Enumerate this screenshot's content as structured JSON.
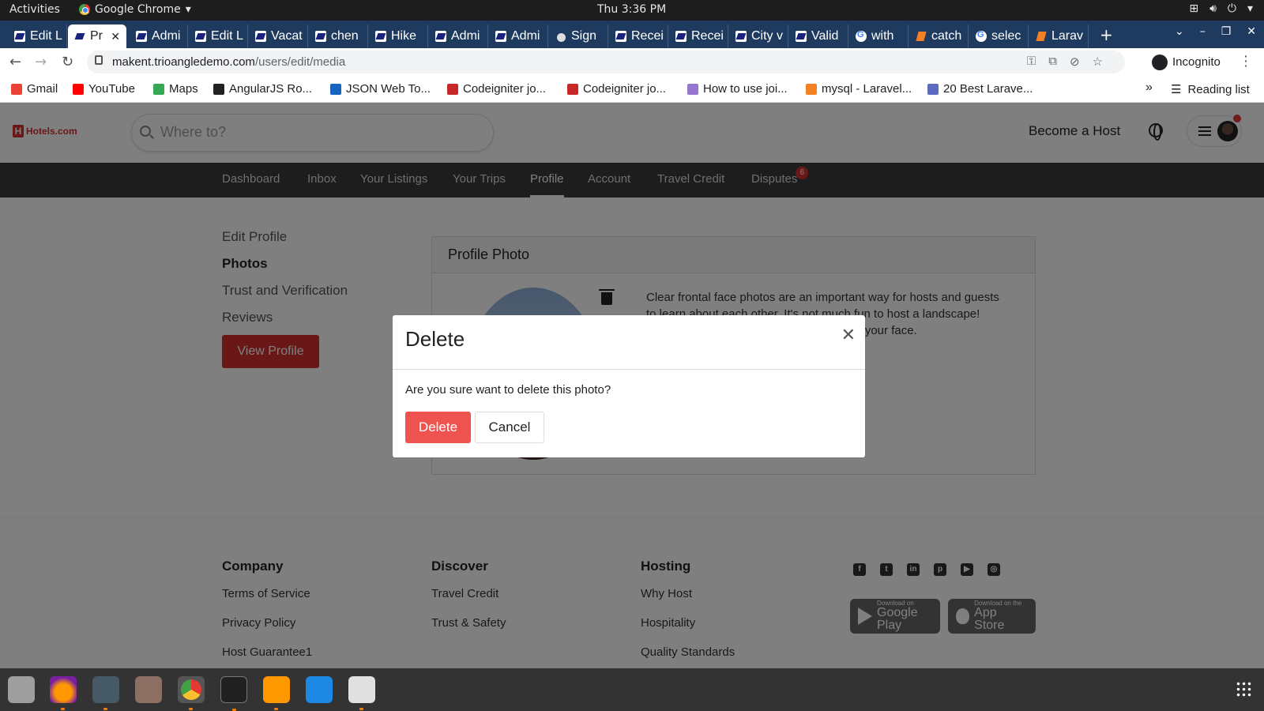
{
  "system_bar": {
    "activities": "Activities",
    "app_name": "Google Chrome",
    "clock": "Thu  3:36 PM"
  },
  "browser": {
    "tabs": [
      {
        "label": "Edit L",
        "icon": "site-favicon"
      },
      {
        "label": "Pr",
        "icon": "site-favicon",
        "active": true
      },
      {
        "label": "Admi",
        "icon": "site-favicon"
      },
      {
        "label": "Edit L",
        "icon": "site-favicon"
      },
      {
        "label": "Vacat",
        "icon": "site-favicon"
      },
      {
        "label": "chen",
        "icon": "site-favicon"
      },
      {
        "label": "Hike",
        "icon": "site-favicon"
      },
      {
        "label": "Admi",
        "icon": "site-favicon"
      },
      {
        "label": "Admi",
        "icon": "site-favicon"
      },
      {
        "label": "Sign",
        "icon": "apple-favicon"
      },
      {
        "label": "Recei",
        "icon": "site-favicon"
      },
      {
        "label": "Recei",
        "icon": "site-favicon"
      },
      {
        "label": "City v",
        "icon": "site-favicon"
      },
      {
        "label": "Valid",
        "icon": "site-favicon"
      },
      {
        "label": "with",
        "icon": "google-favicon"
      },
      {
        "label": "catch",
        "icon": "stackoverflow-favicon"
      },
      {
        "label": "selec",
        "icon": "google-favicon"
      },
      {
        "label": "Larav",
        "icon": "stackoverflow-favicon"
      }
    ],
    "url_host": "makent.trioangledemo.com",
    "url_path": "/users/edit/media",
    "incognito_label": "Incognito",
    "bookmarks": [
      {
        "label": "Gmail",
        "color": "#ea4335"
      },
      {
        "label": "YouTube",
        "color": "#ff0000"
      },
      {
        "label": "Maps",
        "color": "#34a853"
      },
      {
        "label": "AngularJS Ro...",
        "color": "#222222"
      },
      {
        "label": "JSON Web To...",
        "color": "#1565c0"
      },
      {
        "label": "Codeigniter jo...",
        "color": "#c62828"
      },
      {
        "label": "Codeigniter jo...",
        "color": "#c62828"
      },
      {
        "label": "How to use joi...",
        "color": "#9575cd"
      },
      {
        "label": "mysql - Laravel...",
        "color": "#f48024"
      },
      {
        "label": "20 Best Larave...",
        "color": "#5c6bc0"
      }
    ],
    "reading_list": "Reading list"
  },
  "site": {
    "logo_text": "Hotels.com",
    "search_placeholder": "Where to?",
    "become_host": "Become a Host",
    "nav": [
      {
        "label": "Dashboard"
      },
      {
        "label": "Inbox"
      },
      {
        "label": "Your Listings"
      },
      {
        "label": "Your Trips"
      },
      {
        "label": "Profile",
        "active": true
      },
      {
        "label": "Account"
      },
      {
        "label": "Travel Credit"
      },
      {
        "label": "Disputes",
        "badge": "6"
      }
    ],
    "sidebar": {
      "items": [
        "Edit Profile",
        "Photos",
        "Trust and Verification",
        "Reviews"
      ],
      "view_profile": "View Profile"
    },
    "profile_photo": {
      "title": "Profile Photo",
      "description": "Clear frontal face photos are an important way for hosts and guests to learn about each other. It's not much fun to host a landscape! Please upload a photo that clearly shows your face."
    },
    "footer": {
      "company": {
        "title": "Company",
        "links": [
          "Terms of Service",
          "Privacy Policy",
          "Host Guarantee1"
        ]
      },
      "discover": {
        "title": "Discover",
        "links": [
          "Travel Credit",
          "Trust & Safety"
        ]
      },
      "hosting": {
        "title": "Hosting",
        "links": [
          "Why Host",
          "Hospitality",
          "Quality Standards"
        ]
      },
      "social_icons": [
        "facebook-icon",
        "twitter-icon",
        "linkedin-icon",
        "pinterest-icon",
        "youtube-icon",
        "instagram-icon"
      ],
      "google_play": {
        "small": "Download on",
        "big": "Google Play"
      },
      "app_store": {
        "small": "Download on the",
        "big": "App Store"
      }
    }
  },
  "modal": {
    "title": "Delete",
    "message": "Are you sure want to delete this photo?",
    "delete_label": "Delete",
    "cancel_label": "Cancel"
  },
  "dock": {
    "apps": [
      "screenshot-icon",
      "firefox-icon",
      "code-editor-icon",
      "file-manager-icon",
      "chrome-icon",
      "terminal-icon",
      "sublime-icon",
      "vscode-icon",
      "calculator-icon"
    ]
  }
}
